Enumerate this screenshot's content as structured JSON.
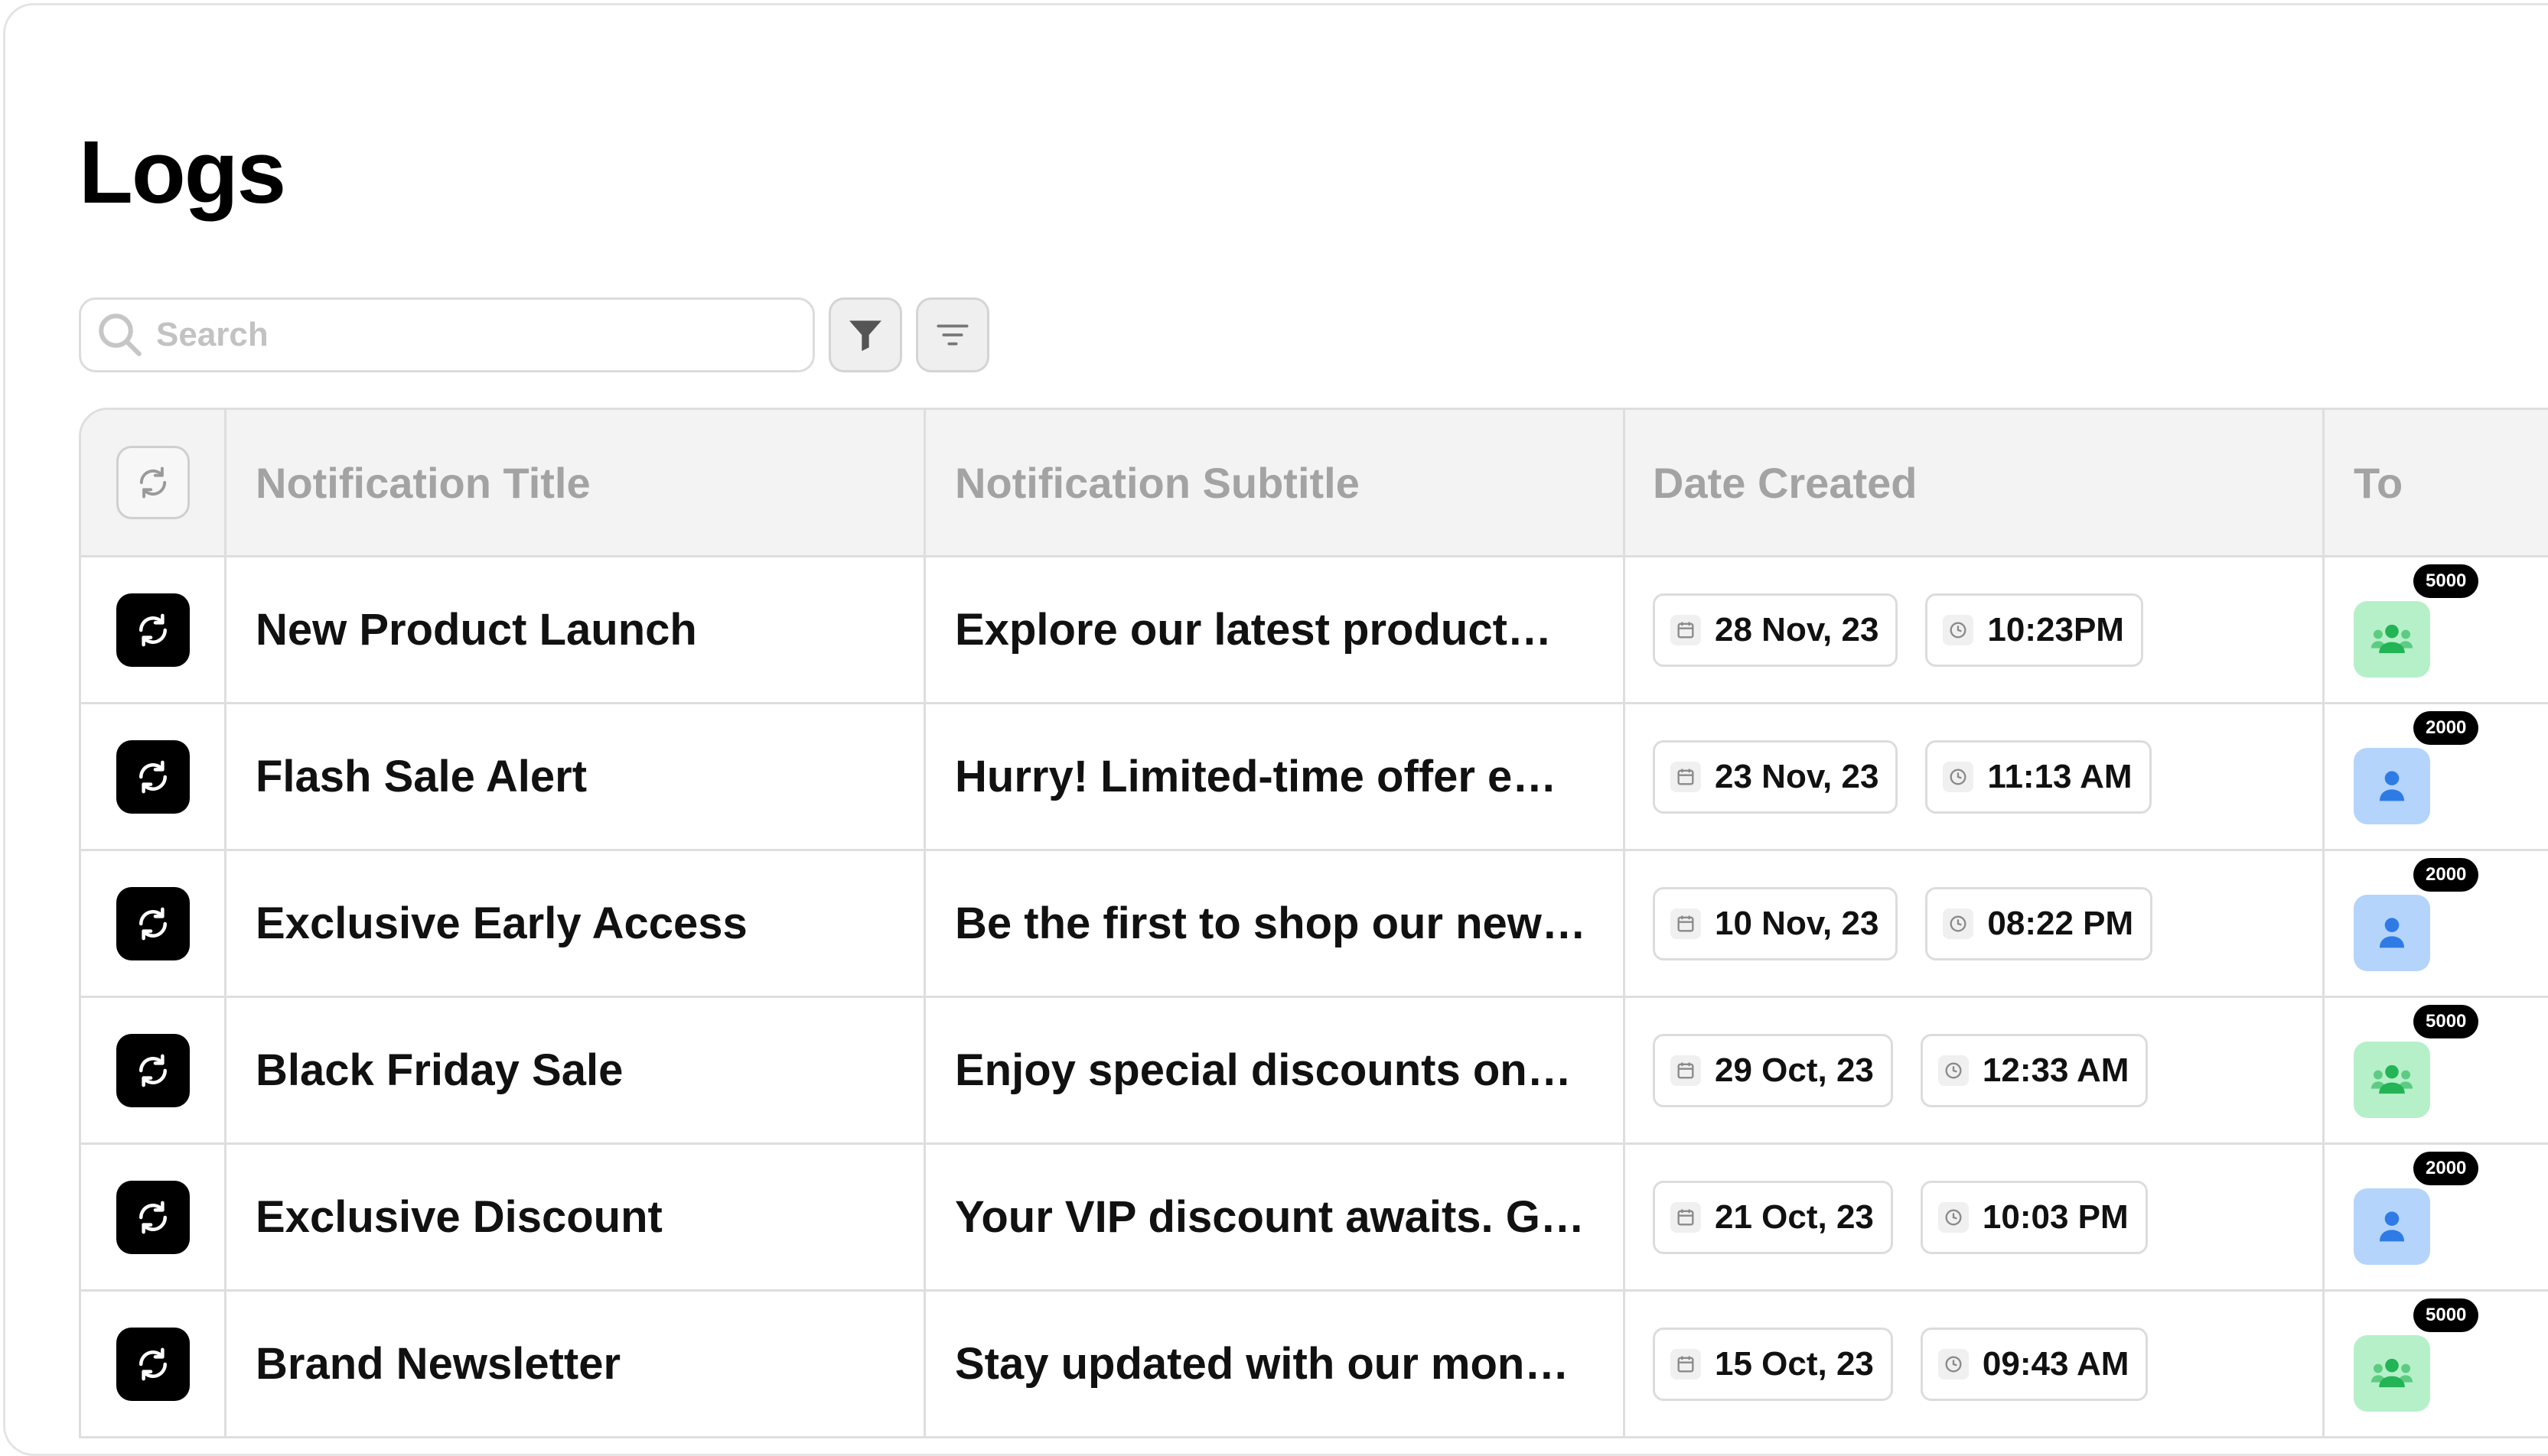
{
  "page": {
    "title": "Logs"
  },
  "toolbar": {
    "search_placeholder": "Search",
    "search_value": "",
    "filter_icon": "funnel-icon",
    "sort_icon": "lines-sort-icon"
  },
  "table": {
    "headers": {
      "title": "Notification Title",
      "subtitle": "Notification Subtitle",
      "date": "Date Created",
      "to": "To"
    },
    "rows": [
      {
        "title": "New Product Launch",
        "subtitle": "Explore our latest product…",
        "date": "28 Nov, 23",
        "time": "10:23PM",
        "audience": "group",
        "count": "5000"
      },
      {
        "title": "Flash Sale Alert",
        "subtitle": "Hurry! Limited-time offer e…",
        "date": "23 Nov, 23",
        "time": "11:13 AM",
        "audience": "single",
        "count": "2000"
      },
      {
        "title": "Exclusive Early Access",
        "subtitle": "Be the first to shop our new…",
        "date": "10 Nov, 23",
        "time": "08:22 PM",
        "audience": "single",
        "count": "2000"
      },
      {
        "title": "Black Friday Sale",
        "subtitle": "Enjoy special discounts on…",
        "date": "29 Oct, 23",
        "time": "12:33 AM",
        "audience": "group",
        "count": "5000"
      },
      {
        "title": "Exclusive Discount",
        "subtitle": "Your VIP discount awaits. G…",
        "date": "21 Oct, 23",
        "time": "10:03 PM",
        "audience": "single",
        "count": "2000"
      },
      {
        "title": "Brand Newsletter",
        "subtitle": "Stay updated with our mon…",
        "date": "15 Oct, 23",
        "time": "09:43 AM",
        "audience": "group",
        "count": "5000"
      }
    ]
  },
  "colors": {
    "group_audience": "#b6f0c8",
    "group_icon": "#22b455",
    "single_audience": "#b4d4fb",
    "single_icon": "#2f7be6",
    "badge": "#000000"
  }
}
